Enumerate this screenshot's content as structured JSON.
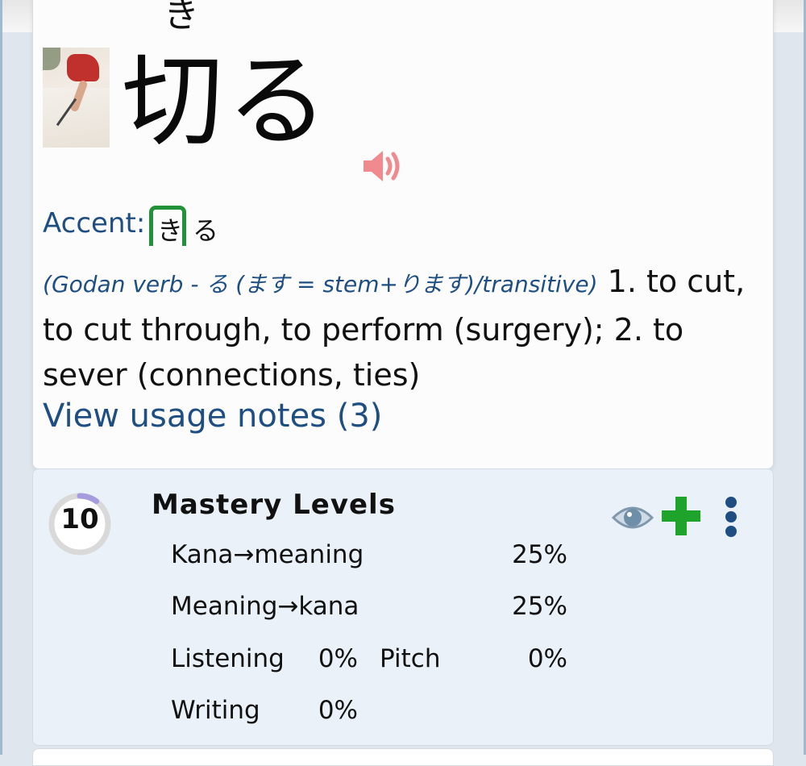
{
  "word": {
    "furigana": "き",
    "headword": "切る",
    "thumbnail_icon": "cutting-fabric-photo",
    "speaker_icon": "speaker-icon",
    "accent": {
      "label": "Accent:",
      "high_mora": "き",
      "low_mora": "る",
      "accent_color": "#21913a"
    },
    "definition": {
      "pos_open": "(",
      "pos_text": "Godan verb - る (ます = stem+ります)/transitive",
      "pos_close": ")",
      "senses": " 1. to cut, to cut through, to perform (surgery); 2. to sever (connections, ties)"
    },
    "usage_link": "View usage notes (3)"
  },
  "mastery": {
    "level": "10",
    "level_progress": 0.1,
    "title": "Mastery Levels",
    "rows": {
      "kana_meaning_label": "Kana→meaning",
      "kana_meaning_value": "25%",
      "meaning_kana_label": "Meaning→kana",
      "meaning_kana_value": "25%",
      "listening_label": "Listening",
      "listening_value": "0%",
      "pitch_label": "Pitch",
      "pitch_value": "0%",
      "writing_label": "Writing",
      "writing_value": "0%"
    }
  },
  "colors": {
    "link": "#1f4f82",
    "card_bg": "#eaf1f8",
    "plus": "#1ea42a",
    "speaker": "#f08a8e"
  }
}
